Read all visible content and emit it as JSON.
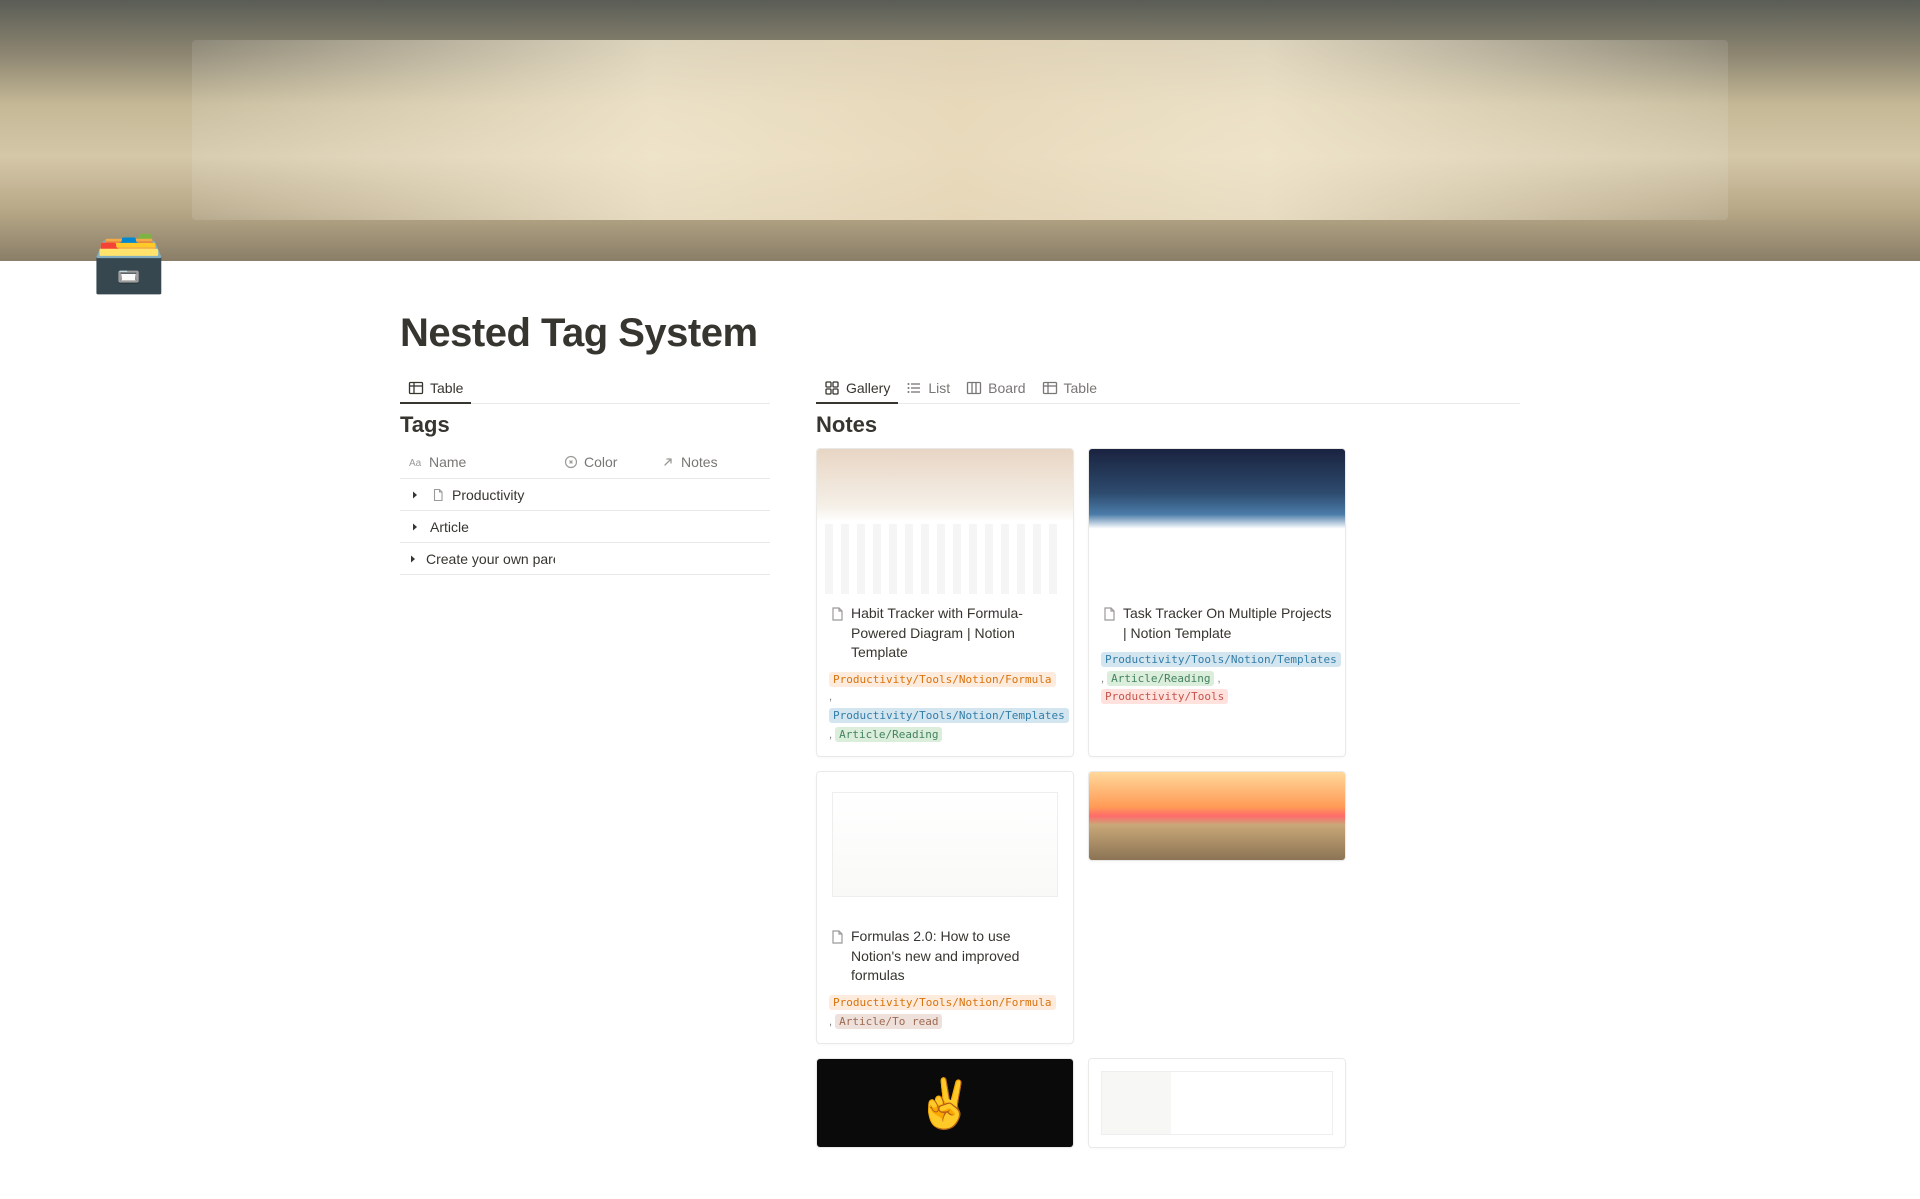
{
  "page": {
    "icon": "🗃️",
    "title": "Nested Tag System"
  },
  "left": {
    "tabs": [
      {
        "id": "table",
        "label": "Table",
        "active": true
      }
    ],
    "section_title": "Tags",
    "columns": {
      "name": "Name",
      "color": "Color",
      "notes": "Notes"
    },
    "rows": [
      {
        "has_toggle": true,
        "has_page_icon": true,
        "name": "Productivity"
      },
      {
        "has_toggle": true,
        "has_page_icon": false,
        "name": "Article"
      },
      {
        "has_toggle": true,
        "has_page_icon": false,
        "name": "Create your own parent tag"
      }
    ]
  },
  "right": {
    "tabs": [
      {
        "id": "gallery",
        "label": "Gallery",
        "active": true
      },
      {
        "id": "list",
        "label": "List",
        "active": false
      },
      {
        "id": "board",
        "label": "Board",
        "active": false
      },
      {
        "id": "table",
        "label": "Table",
        "active": false
      }
    ],
    "section_title": "Notes",
    "cards": [
      {
        "title": "Habit Tracker with Formula-Powered Diagram | Notion Template",
        "cover_class": "cov1",
        "tags": [
          {
            "text": "Productivity/Tools/Notion/Formula",
            "bg": "#fdecdd",
            "fg": "#d9730d"
          },
          {
            "text": "Productivity/Tools/Notion/Templates",
            "bg": "#d3e5ef",
            "fg": "#337ea9"
          },
          {
            "text": "Article/Reading",
            "bg": "#dbeddb",
            "fg": "#448361"
          }
        ]
      },
      {
        "title": "Task Tracker On Multiple Projects | Notion Template",
        "cover_class": "cov2",
        "tags": [
          {
            "text": "Productivity/Tools/Notion/Templates",
            "bg": "#d3e5ef",
            "fg": "#337ea9"
          },
          {
            "text": "Article/Reading",
            "bg": "#dbeddb",
            "fg": "#448361"
          },
          {
            "text": "Productivity/Tools",
            "bg": "#ffe2dd",
            "fg": "#c4554d"
          }
        ]
      },
      {
        "title": "Formulas 2.0: How to use Notion's new and improved formulas",
        "cover_class": "cov3",
        "tags": [
          {
            "text": "Productivity/Tools/Notion/Formula",
            "bg": "#fdecdd",
            "fg": "#d9730d"
          },
          {
            "text": "Article/To read",
            "bg": "#eee0da",
            "fg": "#9f6b53"
          }
        ]
      }
    ],
    "partial_cards": [
      {
        "cover_class": "cov4"
      },
      {
        "cover_class": "cov5"
      },
      {
        "cover_class": "cov6"
      }
    ],
    "tag_colors": {
      "formula": {
        "bg": "#fdecdd",
        "fg": "#d9730d"
      },
      "templates": {
        "bg": "#d3e5ef",
        "fg": "#337ea9"
      },
      "reading": {
        "bg": "#dbeddb",
        "fg": "#448361"
      },
      "tools": {
        "bg": "#ffe2dd",
        "fg": "#c4554d"
      },
      "toread": {
        "bg": "#eee0da",
        "fg": "#9f6b53"
      }
    }
  }
}
